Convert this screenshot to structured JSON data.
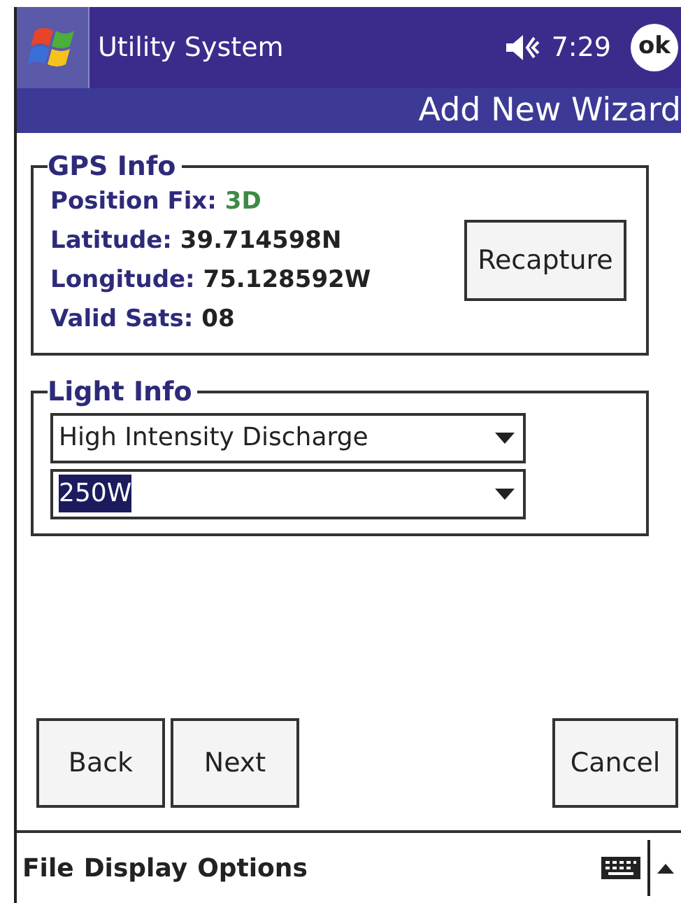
{
  "title_bar": {
    "app_title": "Utility System",
    "time": "7:29",
    "ok_button": "ok"
  },
  "header": {
    "title": "Add New Wizard"
  },
  "gps_info": {
    "legend": "GPS Info",
    "fields": [
      {
        "label": "Position Fix:",
        "value": "3D",
        "kind": "status"
      },
      {
        "label": "Latitude:",
        "value": "39.714598N",
        "kind": "plain"
      },
      {
        "label": "Longitude:",
        "value": "75.128592W",
        "kind": "plain"
      },
      {
        "label": "Valid Sats:",
        "value": "08",
        "kind": "plain"
      }
    ],
    "recapture_button": "Recapture"
  },
  "light_info": {
    "legend": "Light Info",
    "dropdowns": [
      {
        "value": "High Intensity Discharge",
        "highlighted": false
      },
      {
        "value": "250W",
        "highlighted": true
      }
    ]
  },
  "nav_buttons": [
    "Back",
    "Next"
  ],
  "cancel_button": "Cancel",
  "menu": [
    "File",
    "Display",
    "Options"
  ]
}
